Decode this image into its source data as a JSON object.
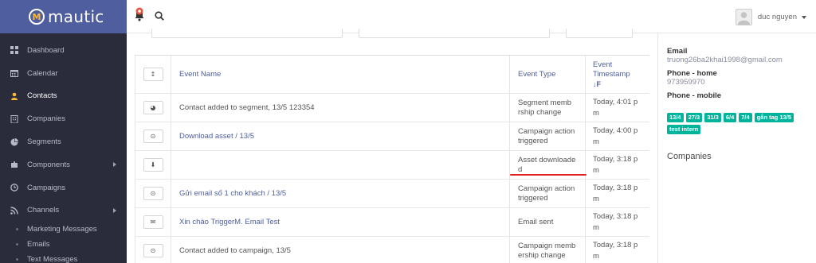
{
  "app": {
    "logo_text": "mautic",
    "logo_mark": "M"
  },
  "sidebar": {
    "items": [
      {
        "label": "Dashboard",
        "icon": "dashboard-icon"
      },
      {
        "label": "Calendar",
        "icon": "calendar-icon"
      },
      {
        "label": "Contacts",
        "icon": "user-icon",
        "active": true
      },
      {
        "label": "Companies",
        "icon": "building-icon"
      },
      {
        "label": "Segments",
        "icon": "pie-chart-icon"
      },
      {
        "label": "Components",
        "icon": "puzzle-icon",
        "has_children": true
      },
      {
        "label": "Campaigns",
        "icon": "clock-icon"
      },
      {
        "label": "Channels",
        "icon": "rss-icon",
        "has_children": true
      }
    ],
    "sub_items": [
      {
        "label": "Marketing Messages"
      },
      {
        "label": "Emails"
      },
      {
        "label": "Text Messages"
      }
    ]
  },
  "header": {
    "user_name": "duc nguyen"
  },
  "table": {
    "columns": {
      "name": "Event Name",
      "type": "Event Type",
      "time_line1": "Event",
      "time_line2": "Timestamp",
      "sort_icon": "↓F"
    },
    "rows": [
      {
        "icon": "pie-chart-icon",
        "glyph": "◕",
        "name": "Contact added to segment, 13/5 123354",
        "type1": "Segment memb",
        "type2": "rship change",
        "time1": "Today, 4:01 p",
        "time2": "m",
        "name_color": "#555555"
      },
      {
        "icon": "clock-icon",
        "glyph": "⊙",
        "name": "Download asset / 13/5",
        "type1": "Campaign action",
        "type2": "triggered",
        "time1": "Today, 4:00 p",
        "time2": "m",
        "name_color": "#4e5e9e"
      },
      {
        "icon": "download-icon",
        "glyph": "⬇",
        "name": "",
        "type1": "Asset downloade",
        "type2": "d",
        "time1": "Today, 3:18 p",
        "time2": "m",
        "name_color": "#4e5e9e"
      },
      {
        "icon": "clock-icon",
        "glyph": "⊙",
        "name": "Gửi email số 1 cho khách / 13/5",
        "type1": "Campaign action",
        "type2": "triggered",
        "time1": "Today, 3:18 p",
        "time2": "m",
        "name_color": "#4e5e9e"
      },
      {
        "icon": "envelope-icon",
        "glyph": "✉",
        "name": "Xin chào TriggerM. Email Test",
        "type1": "Email sent",
        "type2": "",
        "time1": "Today, 3:18 p",
        "time2": "m",
        "name_color": "#4e5e9e"
      },
      {
        "icon": "clock-icon",
        "glyph": "⊙",
        "name": "Contact added to campaign, 13/5",
        "type1": "Campaign memb",
        "type2": "ership change",
        "time1": "Today, 3:18 p",
        "time2": "m",
        "name_color": "#555555"
      }
    ]
  },
  "contact_panel": {
    "email_label": "Email",
    "email_value": "truong26ba2khai1998@gmail.com",
    "phone_home_label": "Phone - home",
    "phone_home_value": "973959970",
    "phone_mobile_label": "Phone - mobile",
    "tags": [
      "13/4",
      "27/3",
      "31/3",
      "6/4",
      "7/4",
      "gắn tag 13/5",
      "test intern"
    ],
    "companies_label": "Companies"
  },
  "colors": {
    "sidebar_bg": "#2a2c3b",
    "logo_bg": "#4e5e9e",
    "accent": "#4e5e9e",
    "tag_bg": "#00b49c",
    "underline": "#e02020"
  }
}
